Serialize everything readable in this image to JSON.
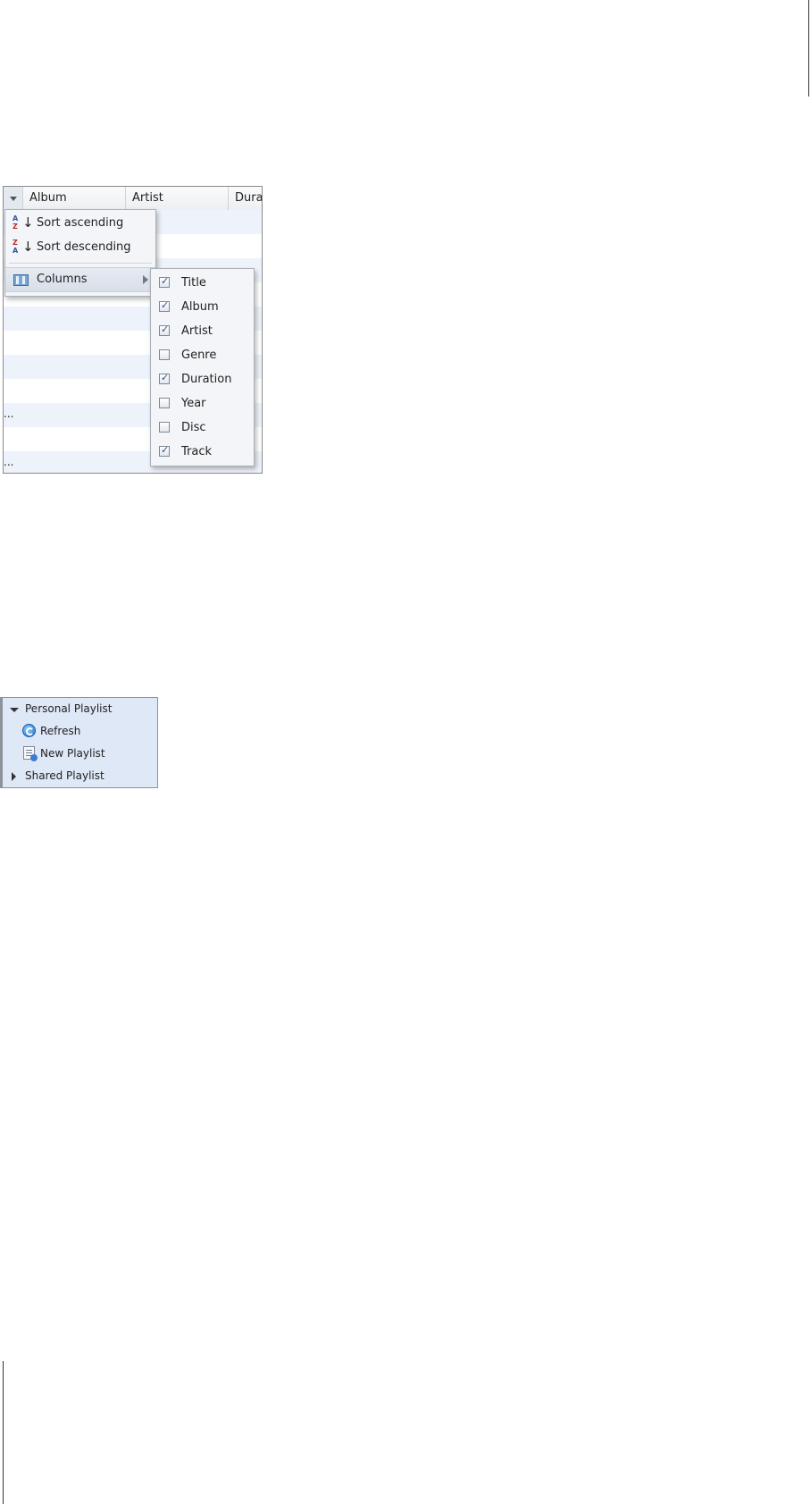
{
  "grid": {
    "columns": [
      "Album",
      "Artist",
      "Dura"
    ],
    "row_ellipsis": [
      "...",
      "..."
    ]
  },
  "menu": {
    "sort_ascending": {
      "label": "Sort ascending",
      "icon": "sort-az-icon",
      "letters": [
        "A",
        "Z"
      ]
    },
    "sort_descending": {
      "label": "Sort descending",
      "icon": "sort-za-icon",
      "letters": [
        "Z",
        "A"
      ]
    },
    "columns": {
      "label": "Columns",
      "icon": "columns-icon"
    }
  },
  "columns_submenu": [
    {
      "label": "Title",
      "checked": true
    },
    {
      "label": "Album",
      "checked": true
    },
    {
      "label": "Artist",
      "checked": true
    },
    {
      "label": "Genre",
      "checked": false
    },
    {
      "label": "Duration",
      "checked": true
    },
    {
      "label": "Year",
      "checked": false
    },
    {
      "label": "Disc",
      "checked": false
    },
    {
      "label": "Track",
      "checked": true
    }
  ],
  "tree": {
    "personal": "Personal Playlist",
    "refresh": "Refresh",
    "new_playlist": "New Playlist",
    "shared": "Shared Playlist"
  },
  "colors": {
    "row_alt": "#eef3fb",
    "menu_bg": "#f3f5f8",
    "tree_bg": "#dfe8f6",
    "check_color": "#2d4f8c"
  }
}
